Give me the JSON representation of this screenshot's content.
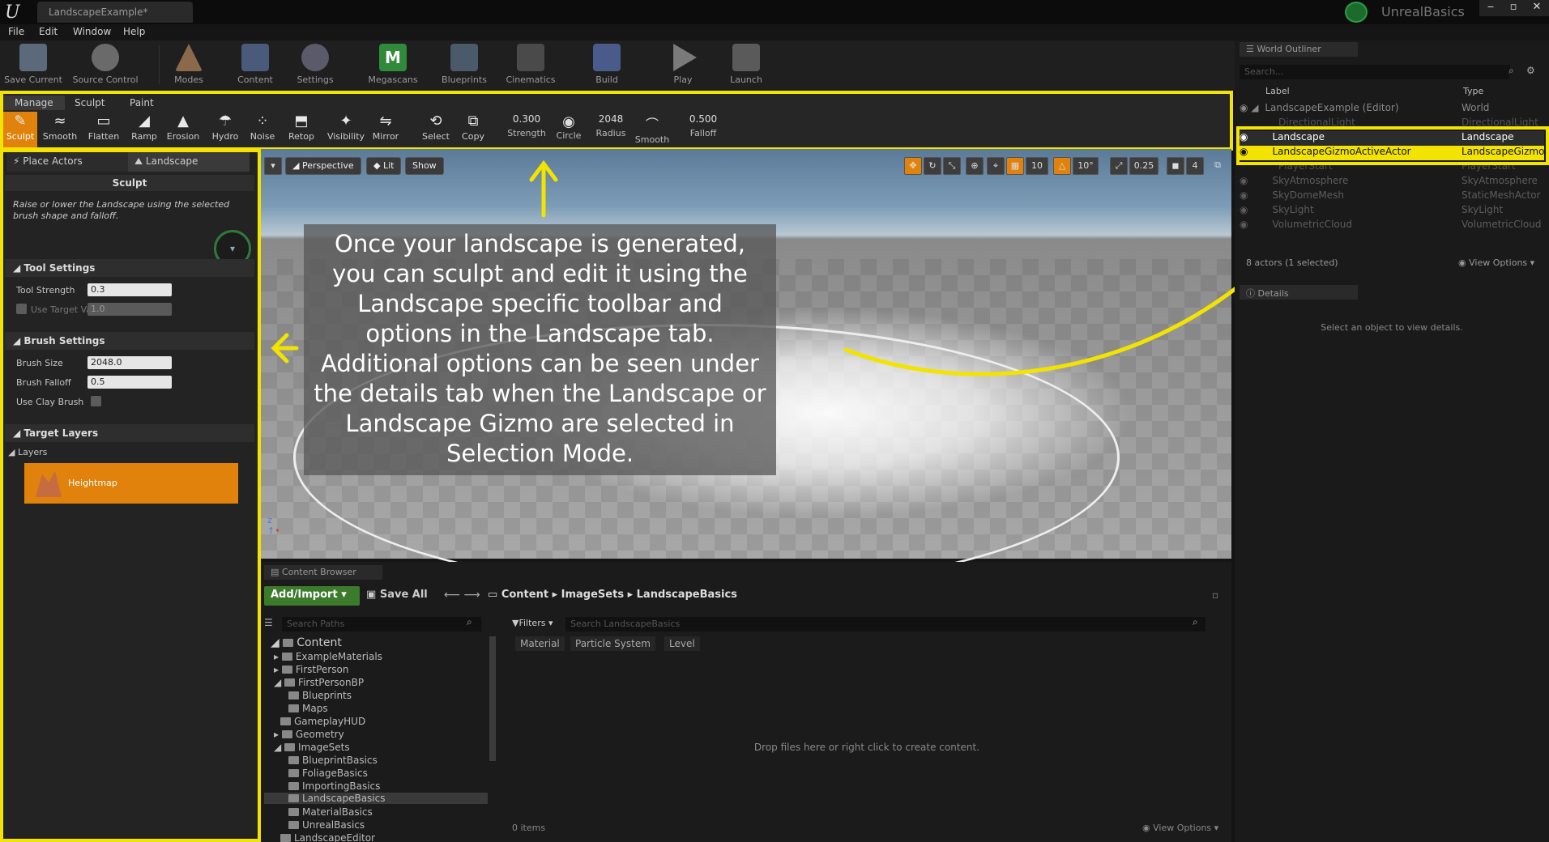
{
  "titlebar": {
    "doc_tab": "LandscapeExample*",
    "brand": "UnrealBasics",
    "min": "‒",
    "max": "▫",
    "close": "✕"
  },
  "menu": [
    "File",
    "Edit",
    "Window",
    "Help"
  ],
  "toolbar": [
    {
      "label": "Save Current",
      "icon": "save-icon"
    },
    {
      "label": "Source Control",
      "icon": "source-control-icon"
    },
    {
      "label": "Modes",
      "icon": "modes-icon"
    },
    {
      "label": "Content",
      "icon": "content-icon"
    },
    {
      "label": "Settings",
      "icon": "settings-icon"
    },
    {
      "label": "Megascans",
      "icon": "megascans-icon"
    },
    {
      "label": "Blueprints",
      "icon": "blueprints-icon"
    },
    {
      "label": "Cinematics",
      "icon": "cinematics-icon"
    },
    {
      "label": "Build",
      "icon": "build-icon"
    },
    {
      "label": "Play",
      "icon": "play-icon"
    },
    {
      "label": "Launch",
      "icon": "launch-icon"
    }
  ],
  "landscape_modes": {
    "tabs": [
      "Manage",
      "Sculpt",
      "Paint"
    ],
    "active_tab": "Sculpt"
  },
  "sculpt_tools": [
    "Sculpt",
    "Smooth",
    "Flatten",
    "Ramp",
    "Erosion",
    "Hydro",
    "Noise",
    "Retop",
    "Visibility",
    "Mirror"
  ],
  "selection_tools": [
    "Select",
    "Copy"
  ],
  "brush_values": {
    "strength": {
      "value": "0.300",
      "label": "Strength"
    },
    "circle": {
      "label": "Circle"
    },
    "radius": {
      "value": "2048",
      "label": "Radius"
    },
    "smooth": {
      "label": "Smooth"
    },
    "falloff": {
      "value": "0.500",
      "label": "Falloff"
    }
  },
  "left_panel": {
    "tabs": [
      "Place Actors",
      "Landscape"
    ],
    "mode_title": "Sculpt",
    "description": "Raise or lower the Landscape using the selected brush shape and falloff.",
    "tool_settings": {
      "title": "Tool Settings",
      "tool_strength_label": "Tool Strength",
      "tool_strength": "0.3",
      "use_target_label": "Use Target Va",
      "use_target": "1.0"
    },
    "brush_settings": {
      "title": "Brush Settings",
      "brush_size_label": "Brush Size",
      "brush_size": "2048.0",
      "brush_falloff_label": "Brush Falloff",
      "brush_falloff": "0.5",
      "clay_label": "Use Clay Brush"
    },
    "target_layers": {
      "title": "Target Layers",
      "layers_label": "Layers",
      "heightmap": "Heightmap"
    }
  },
  "viewport": {
    "perspective": "Perspective",
    "lit": "Lit",
    "show": "Show",
    "grid": "10",
    "angle": "10°",
    "scale": "0.25",
    "speed": "4"
  },
  "callout": "Once your landscape is generated, you can sculpt and edit it using the Landscape specific toolbar and options in the Landscape tab. Additional options can be seen under the details tab when the Landscape or Landscape Gizmo are selected in Selection Mode.",
  "outliner": {
    "title": "World Outliner",
    "search_placeholder": "Search...",
    "col_label": "Label",
    "col_type": "Type",
    "rows": [
      {
        "label": "LandscapeExample (Editor)",
        "type": "World"
      },
      {
        "label": "DirectionalLight",
        "type": "DirectionalLight"
      },
      {
        "label": "Landscape",
        "type": "Landscape"
      },
      {
        "label": "LandscapeGizmoActiveActor",
        "type": "LandscapeGizmoA"
      },
      {
        "label": "PlayerStart",
        "type": "PlayerStart"
      },
      {
        "label": "SkyAtmosphere",
        "type": "SkyAtmosphere"
      },
      {
        "label": "SkyDomeMesh",
        "type": "StaticMeshActor"
      },
      {
        "label": "SkyLight",
        "type": "SkyLight"
      },
      {
        "label": "VolumetricCloud",
        "type": "VolumetricCloud"
      }
    ],
    "status": "8 actors (1 selected)",
    "view_options": "View Options"
  },
  "details": {
    "title": "Details",
    "empty": "Select an object to view details."
  },
  "content_browser": {
    "title": "Content Browser",
    "add_import": "Add/Import",
    "save_all": "Save All",
    "breadcrumb": [
      "Content",
      "ImageSets",
      "LandscapeBasics"
    ],
    "search_paths": "Search Paths",
    "filters": "Filters",
    "search_assets": "Search LandscapeBasics",
    "filter_chips": [
      "Material",
      "Particle System",
      "Level"
    ],
    "tree": [
      {
        "name": "Content",
        "depth": 0
      },
      {
        "name": "ExampleMaterials",
        "depth": 1
      },
      {
        "name": "FirstPerson",
        "depth": 1
      },
      {
        "name": "FirstPersonBP",
        "depth": 1
      },
      {
        "name": "Blueprints",
        "depth": 2
      },
      {
        "name": "Maps",
        "depth": 2
      },
      {
        "name": "GameplayHUD",
        "depth": 1
      },
      {
        "name": "Geometry",
        "depth": 1
      },
      {
        "name": "ImageSets",
        "depth": 1
      },
      {
        "name": "BlueprintBasics",
        "depth": 2
      },
      {
        "name": "FoliageBasics",
        "depth": 2
      },
      {
        "name": "ImportingBasics",
        "depth": 2
      },
      {
        "name": "LandscapeBasics",
        "depth": 2
      },
      {
        "name": "MaterialBasics",
        "depth": 2
      },
      {
        "name": "UnrealBasics",
        "depth": 2
      },
      {
        "name": "LandscapeEditor",
        "depth": 1
      }
    ],
    "drop_hint": "Drop files here or right click to create content.",
    "item_count": "0 items",
    "view_options": "View Options"
  },
  "colors": {
    "highlight": "#f2e300",
    "active_tool": "#e0820b",
    "selected_row": "#f2e300"
  }
}
